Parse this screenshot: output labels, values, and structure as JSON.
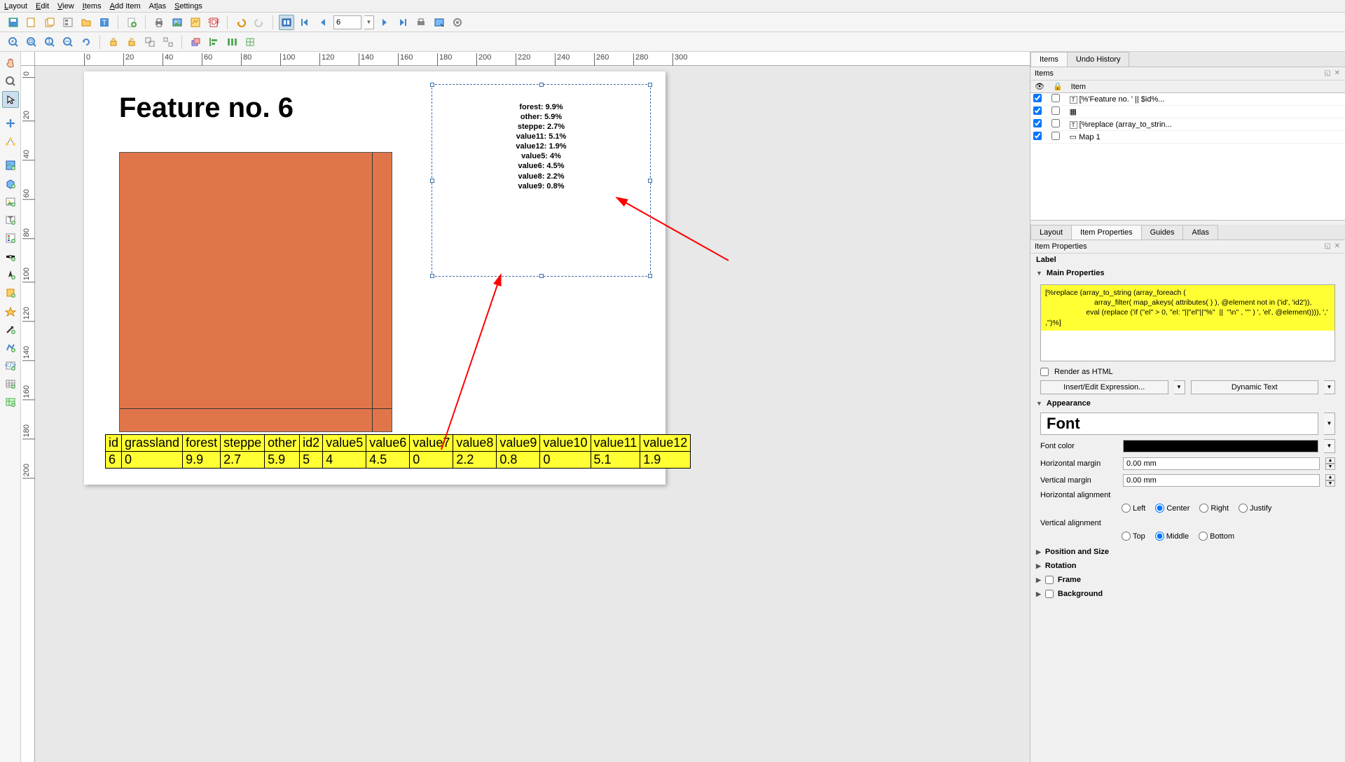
{
  "menu": {
    "items": [
      "Layout",
      "Edit",
      "View",
      "Items",
      "Add Item",
      "Atlas",
      "Settings"
    ]
  },
  "toolbar1": {
    "page_input": "6"
  },
  "panel_tabs_top": {
    "a": "Items",
    "b": "Undo History"
  },
  "items_panel": {
    "title": "Items",
    "cols": {
      "eye": "",
      "lock": "",
      "item": "Item"
    },
    "rows": [
      {
        "label": "[%'Feature no. ' || $id%..."
      },
      {
        "label": "<Attribute table frame>"
      },
      {
        "label": "[%replace (array_to_strin..."
      },
      {
        "label": "Map 1"
      }
    ]
  },
  "panel_tabs_mid": {
    "a": "Layout",
    "b": "Item Properties",
    "c": "Guides",
    "d": "Atlas"
  },
  "item_props": {
    "title": "Item Properties",
    "subtitle": "Label",
    "main_properties": "Main Properties",
    "expression": "[%replace (array_to_string (array_foreach (\n                        array_filter( map_akeys( attributes( ) ), @element not in ('id', 'id2')),\n                    eval (replace ('if (\"el\" > 0, \"el: \"||\"el\"||\"%\"  ||  ''\\n'' , '''' ) ', 'el', @element)))), ',' ,'')%]",
    "render_html": "Render as HTML",
    "insert_expr": "Insert/Edit Expression...",
    "dynamic_text": "Dynamic Text",
    "appearance": "Appearance",
    "font_label": "Font",
    "font_color": "Font color",
    "h_margin": "Horizontal margin",
    "h_margin_v": "0.00 mm",
    "v_margin": "Vertical margin",
    "v_margin_v": "0.00 mm",
    "h_align": "Horizontal alignment",
    "h_align_opts": {
      "left": "Left",
      "center": "Center",
      "right": "Right",
      "justify": "Justify"
    },
    "v_align": "Vertical alignment",
    "v_align_opts": {
      "top": "Top",
      "middle": "Middle",
      "bottom": "Bottom"
    },
    "pos_size": "Position and Size",
    "rotation": "Rotation",
    "frame": "Frame",
    "background": "Background"
  },
  "page": {
    "title": "Feature no. 6",
    "label_lines": [
      "forest: 9.9%",
      "other: 5.9%",
      "steppe: 2.7%",
      "value11: 5.1%",
      "value12: 1.9%",
      "value5: 4%",
      "value6: 4.5%",
      "value8: 2.2%",
      "value9: 0.8%"
    ],
    "table": {
      "headers": [
        "id",
        "grassland",
        "forest",
        "steppe",
        "other",
        "id2",
        "value5",
        "value6",
        "value7",
        "value8",
        "value9",
        "value10",
        "value11",
        "value12"
      ],
      "row": [
        "6",
        "0",
        "9.9",
        "2.7",
        "5.9",
        "5",
        "4",
        "4.5",
        "0",
        "2.2",
        "0.8",
        "0",
        "5.1",
        "1.9"
      ]
    }
  },
  "ruler_h": [
    "0",
    "20",
    "40",
    "60",
    "80",
    "100",
    "120",
    "140",
    "160",
    "180",
    "200",
    "220",
    "240",
    "260",
    "280",
    "300"
  ],
  "ruler_v": [
    "0",
    "20",
    "40",
    "60",
    "80",
    "100",
    "120",
    "140",
    "160",
    "180",
    "200"
  ]
}
